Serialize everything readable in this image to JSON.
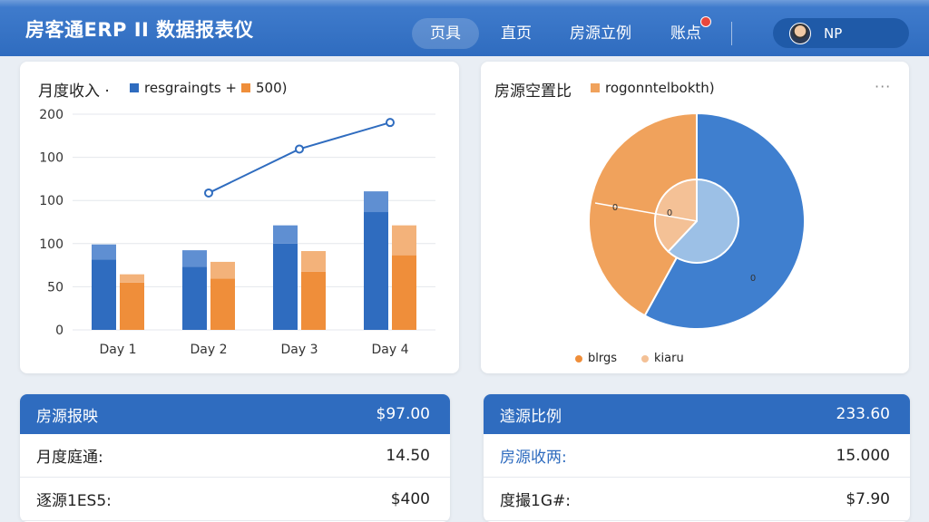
{
  "header": {
    "title": "房客通ERP II 数据报表仪",
    "nav": [
      {
        "label": "页具",
        "active": true
      },
      {
        "label": "直页",
        "active": false
      },
      {
        "label": "房源立例",
        "active": false
      },
      {
        "label": "账点",
        "active": false
      }
    ],
    "user_name": "NP"
  },
  "bar_card": {
    "title": "月度收入 ·",
    "legend": [
      "resgraingts +",
      "500)"
    ]
  },
  "pie_card": {
    "title": "房源空置比",
    "legend_top": "rogonntelbokth)",
    "legend_bottom": [
      "blrgs",
      "kiaru"
    ],
    "labels": [
      "0",
      "0",
      "0"
    ]
  },
  "chart_data": [
    {
      "type": "bar",
      "categories": [
        "Day 1",
        "Day 2",
        "Day 3",
        "Day 4"
      ],
      "y_ticks": [
        "0",
        "50",
        "100",
        "100",
        "100",
        "200"
      ],
      "series": [
        {
          "name": "resgraingts",
          "color": "#2f6cbf",
          "color_light": "#5f8fd2",
          "base": [
            85,
            76,
            104,
            142
          ],
          "top": [
            18,
            20,
            22,
            25
          ]
        },
        {
          "name": "500",
          "color": "#ef8e3a",
          "color_light": "#f3b27a",
          "base": [
            57,
            62,
            70,
            90
          ],
          "top": [
            10,
            20,
            25,
            36
          ]
        }
      ],
      "line": {
        "points": [
          [
            1,
            165
          ],
          [
            2,
            218
          ],
          [
            3,
            250
          ]
        ],
        "color": "#2f6cbf"
      },
      "ylim": [
        0,
        260
      ]
    },
    {
      "type": "pie",
      "slices": [
        {
          "value": 58,
          "color": "#3f7fcf"
        },
        {
          "value": 42,
          "color": "#f0a25c"
        }
      ],
      "inner_slices": [
        {
          "value": 62,
          "color": "#9cc0e6"
        },
        {
          "value": 38,
          "color": "#f4c196"
        }
      ]
    }
  ],
  "table_left": {
    "header": {
      "label": "房源报映",
      "value": "$97.00"
    },
    "rows": [
      {
        "label": "月度庭通:",
        "value": "14.50"
      },
      {
        "label": "逐源1ES5:",
        "value": "$400"
      }
    ]
  },
  "table_right": {
    "header": {
      "label": "逵源比例",
      "value": "233.60"
    },
    "rows": [
      {
        "label": "房源收两:",
        "value": "15.000"
      },
      {
        "label": "度撮1G#:",
        "value": "$7.90"
      }
    ]
  }
}
